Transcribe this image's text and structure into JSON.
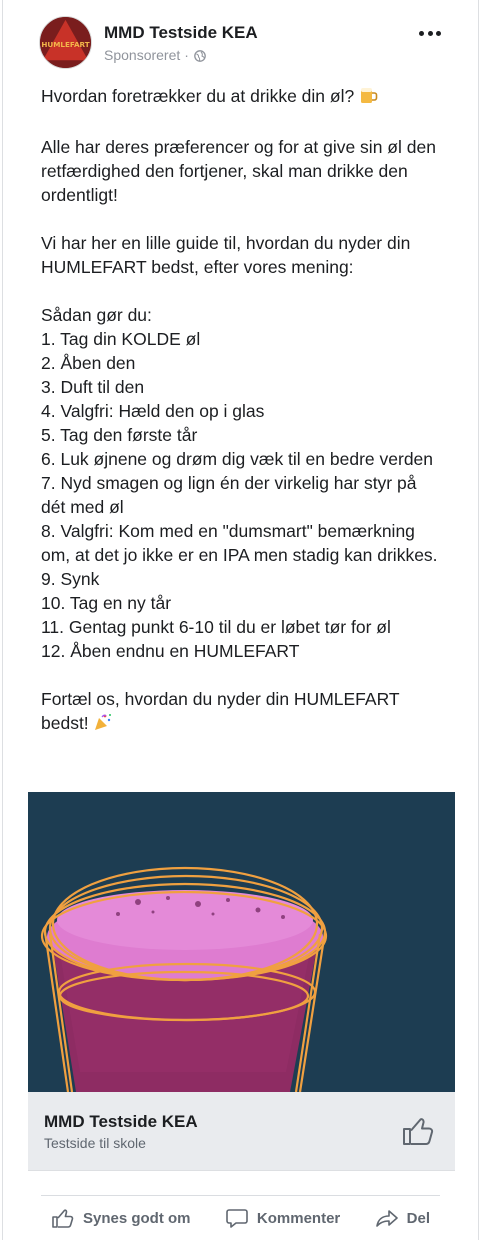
{
  "post": {
    "page_name": "MMD Testside KEA",
    "sponsored": "Sponsoreret",
    "separator": "·",
    "avatar_text": "HUMLEFART",
    "text_blocks": [
      [
        "Hvordan foretrækker du at drikke din øl?"
      ],
      [
        "Alle har deres præferencer og for at give sin øl den retfærdighed den fortjener, skal man drikke den ordentligt!"
      ],
      [
        "Vi har her en lille guide til, hvordan du nyder din HUMLEFART bedst, efter vores mening:"
      ],
      [
        "Sådan gør du:",
        "1. Tag din KOLDE øl",
        "2. Åben den",
        "3. Duft til den",
        "4. Valgfri: Hæld den op i glas",
        "5. Tag den første tår",
        "6. Luk øjnene og drøm dig væk til en bedre verden",
        "7. Nyd smagen og lign én der virkelig har styr på dét med øl",
        "8. Valgfri: Kom med en \"dumsmart\" bemærkning om, at det jo ikke er en IPA men stadig kan drikkes.",
        "9. Synk",
        "10. Tag en ny tår",
        "11. Gentag punkt 6-10 til du er løbet tør for øl",
        "12. Åben endnu en HUMLEFART"
      ],
      [
        "Fortæl os, hvordan du nyder din HUMLEFART bedst!"
      ]
    ],
    "emojis": [
      "beer-mug-icon",
      "party-popper-icon"
    ]
  },
  "link_preview": {
    "title": "MMD Testside KEA",
    "subtitle": "Testside til skole"
  },
  "actions": {
    "like": "Synes godt om",
    "comment": "Kommenter",
    "share": "Del"
  },
  "colors": {
    "image_background": "#1d3d52",
    "beer_pink": "#e07ad0",
    "glass_orange": "#f0a040",
    "text": "#1c1e21",
    "secondary_text": "#606770",
    "link_box_bg": "#e9ebee"
  }
}
